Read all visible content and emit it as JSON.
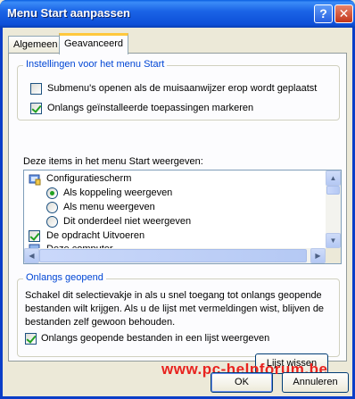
{
  "window": {
    "title": "Menu Start aanpassen",
    "help_glyph": "?",
    "close_glyph": "✕"
  },
  "tabs": [
    {
      "label": "Algemeen",
      "active": false
    },
    {
      "label": "Geavanceerd",
      "active": true
    }
  ],
  "settings_group": {
    "title": "Instellingen voor het menu Start",
    "options": [
      {
        "label": "Submenu's openen als de muisaanwijzer erop wordt geplaatst",
        "checked": false
      },
      {
        "label": "Onlangs geïnstalleerde toepassingen markeren",
        "checked": true
      }
    ]
  },
  "items_list": {
    "heading": "Deze items in het menu Start weergeven:",
    "rows": [
      {
        "type": "category",
        "label": "Configuratiescherm",
        "icon": "control-panel-icon"
      },
      {
        "type": "radio",
        "label": "Als koppeling weergeven",
        "checked": true
      },
      {
        "type": "radio",
        "label": "Als menu weergeven",
        "checked": false
      },
      {
        "type": "radio",
        "label": "Dit onderdeel niet weergeven",
        "checked": false
      },
      {
        "type": "checkbox",
        "label": "De opdracht Uitvoeren",
        "checked": true
      },
      {
        "type": "category",
        "label": "Deze computer",
        "icon": "my-computer-icon"
      }
    ]
  },
  "recent_group": {
    "title": "Onlangs geopend",
    "description": "Schakel dit selectievakje in als u snel toegang tot onlangs geopende bestanden wilt krijgen. Als u de lijst met vermeldingen wist, blijven de bestanden zelf gewoon behouden.",
    "option": {
      "label": "Onlangs geopende bestanden in een lijst weergeven",
      "checked": true
    },
    "clear_button": "Lijst wissen"
  },
  "footer": {
    "ok_label": "OK",
    "cancel_label": "Annuleren",
    "watermark": "www.pc-helpforum.be"
  },
  "colors": {
    "title_bar": "#0d4fd8",
    "group_title": "#0046d5",
    "check_mark": "#21a121",
    "watermark": "#e8231f"
  }
}
